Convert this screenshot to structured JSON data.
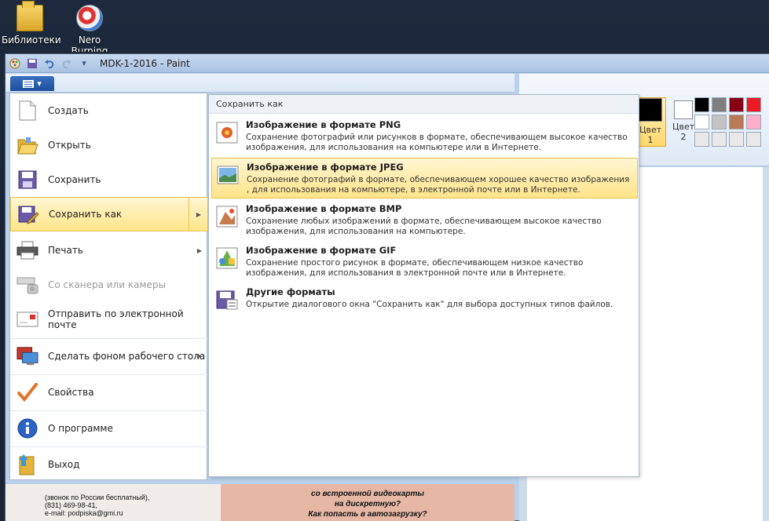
{
  "desktop": {
    "icons": [
      {
        "label": "Библиотеки",
        "icon": "library-folder-icon"
      },
      {
        "label": "Nero Burning ROM",
        "icon": "nero-disc-icon"
      }
    ]
  },
  "window": {
    "title": "MDK-1-2016 - Paint",
    "quick_access": [
      "paint-icon",
      "save-icon",
      "undo-icon",
      "redo-icon",
      "customize-icon"
    ]
  },
  "colors": {
    "color1_label": "Цвет 1",
    "color2_label": "Цвет 2",
    "color1": "#000000",
    "color2": "#ffffff",
    "palette": [
      "#000000",
      "#7f7f7f",
      "#880015",
      "#ed1c24",
      "#ffffff",
      "#c3c3c3",
      "#b97a57",
      "#ffaec9",
      "#e8e8e8",
      "#e8e8e8",
      "#e8e8e8",
      "#e8e8e8"
    ]
  },
  "menu": {
    "items": [
      {
        "label": "Создать",
        "icon": "new-file-icon"
      },
      {
        "label": "Открыть",
        "icon": "open-folder-icon"
      },
      {
        "label": "Сохранить",
        "icon": "save-icon"
      },
      {
        "label": "Сохранить как",
        "icon": "save-as-icon"
      },
      {
        "label": "Печать",
        "icon": "printer-icon"
      },
      {
        "label": "Со сканера или камеры",
        "icon": "scanner-icon"
      },
      {
        "label": "Отправить по электронной почте",
        "icon": "email-icon"
      },
      {
        "label": "Сделать фоном рабочего стола",
        "icon": "desktop-background-icon"
      },
      {
        "label": "Свойства",
        "icon": "checkmark-icon"
      },
      {
        "label": "О программе",
        "icon": "info-icon"
      },
      {
        "label": "Выход",
        "icon": "exit-icon"
      }
    ]
  },
  "submenu": {
    "header": "Сохранить как",
    "items": [
      {
        "title": "Изображение в формате PNG",
        "desc": "Сохранение фотографий или рисунков в формате, обеспечивающем высокое качество изображения, для использования на компьютере или в Интернете.",
        "icon": "png-image-icon"
      },
      {
        "title": "Изображение в формате JPEG",
        "desc": "Сохранение фотографий в формате, обеспечивающем хорошее качество изображения , для использования на компьютере, в электронной почте или в Интернете.",
        "icon": "jpeg-image-icon"
      },
      {
        "title": "Изображение в формате BMP",
        "desc": "Сохранение любых изображений в формате, обеспечивающем высокое качество изображения, для использования на компьютере.",
        "icon": "bmp-image-icon"
      },
      {
        "title": "Изображение в формате GIF",
        "desc": "Сохранение простого рисунок в формате, обеспечивающем низкое качество изображения, для использования в электронной почте или в Интернете.",
        "icon": "gif-image-icon"
      },
      {
        "title": "Другие форматы",
        "desc": "Открытие диалогового окна \"Сохранить как\" для выбора доступных типов файлов.",
        "icon": "other-formats-icon"
      }
    ]
  },
  "document": {
    "left_lines": [
      "(звонок по России бесплатный),",
      "(831) 469-98-41,",
      "e-mail: podpiska@gmi.ru"
    ],
    "right_lines": [
      "со встроенной видеокарты",
      "на дискретную?",
      "Как попасть в автозагрузку?"
    ]
  }
}
